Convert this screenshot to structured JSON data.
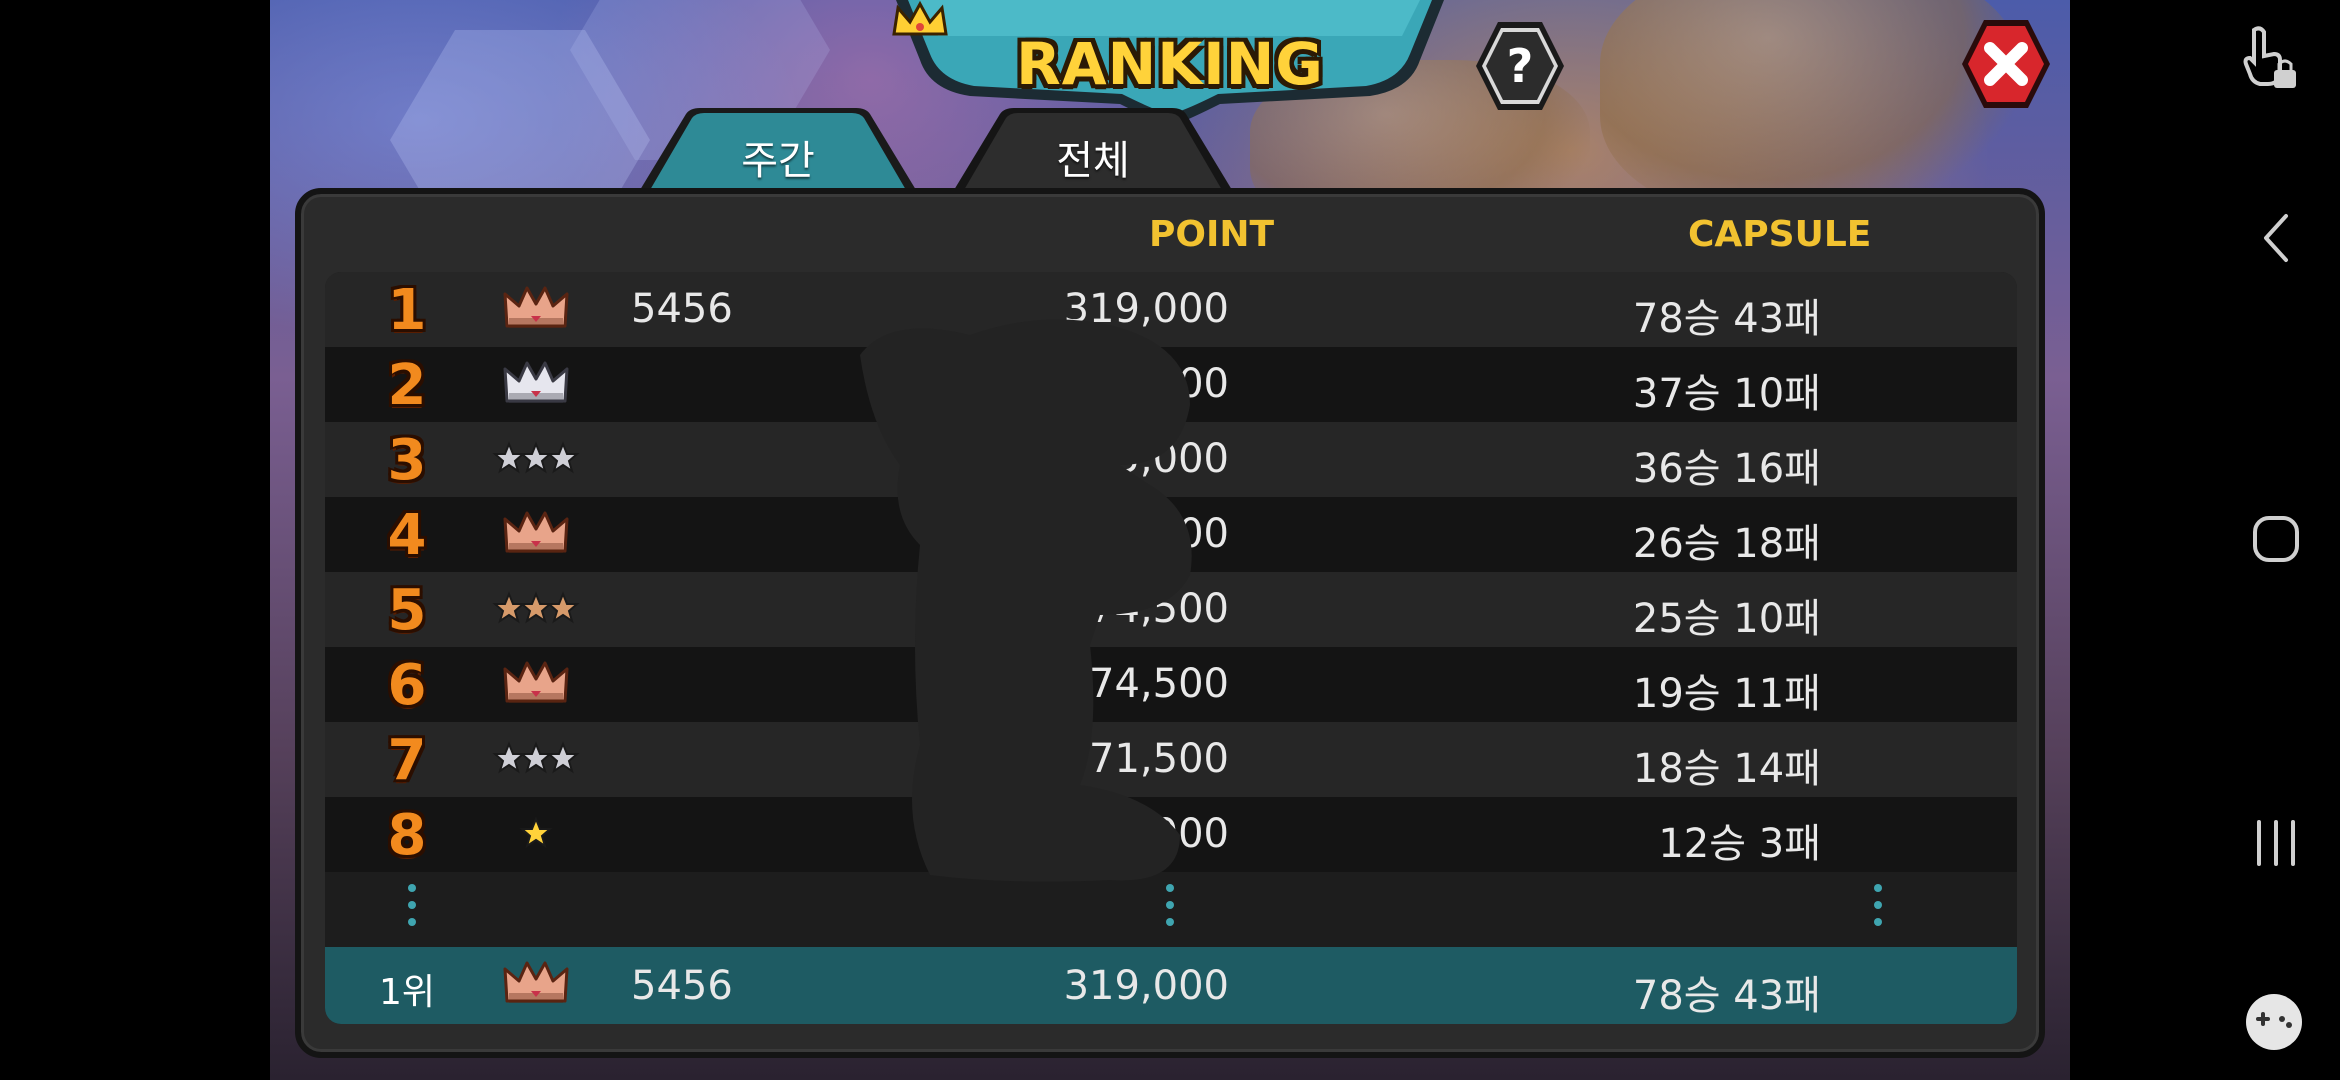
{
  "title": "RANKING",
  "tabs": [
    {
      "label": "주간",
      "active": true
    },
    {
      "label": "전체",
      "active": false
    }
  ],
  "columns": {
    "point": "POINT",
    "capsule": "CAPSULE"
  },
  "rows": [
    {
      "rank": "1",
      "badge": "bronze-crown",
      "name": "5456",
      "point": "319,000",
      "capsule": "78승 43패"
    },
    {
      "rank": "2",
      "badge": "silver-crown",
      "name": "",
      "point": "152,000",
      "capsule": "37승 10패"
    },
    {
      "rank": "3",
      "badge": "silver-3-stars",
      "name": "",
      "point": "135,000",
      "capsule": "36승 16패"
    },
    {
      "rank": "4",
      "badge": "bronze-crown",
      "name": "",
      "point": "111,500",
      "capsule": "26승 18패"
    },
    {
      "rank": "5",
      "badge": "bronze-3-stars",
      "name": "",
      "point": "74,500",
      "capsule": "25승 10패"
    },
    {
      "rank": "6",
      "badge": "bronze-crown",
      "name": "",
      "point": "74,500",
      "capsule": "19승 11패"
    },
    {
      "rank": "7",
      "badge": "silver-3-stars",
      "name": "",
      "point": "71,500",
      "capsule": "18승 14패"
    },
    {
      "rank": "8",
      "badge": "gold-1-star",
      "name": "",
      "point": "58,000",
      "capsule": "12승 3패"
    }
  ],
  "my_rank": {
    "rank": "1위",
    "badge": "bronze-crown",
    "name": "5456",
    "point": "319,000",
    "capsule": "78승 43패"
  },
  "colors": {
    "accent_gold": "#f2c230",
    "rank_orange": "#f28a1e",
    "highlight_row": "#1e5b63",
    "tab_active": "#2e8a96",
    "close_red": "#d8262c"
  },
  "icons": {
    "help": "question-mark-icon",
    "close": "close-x-icon",
    "nav": [
      "touch-lock-icon",
      "back-icon",
      "home-icon",
      "recents-icon",
      "game-controller-icon"
    ]
  }
}
